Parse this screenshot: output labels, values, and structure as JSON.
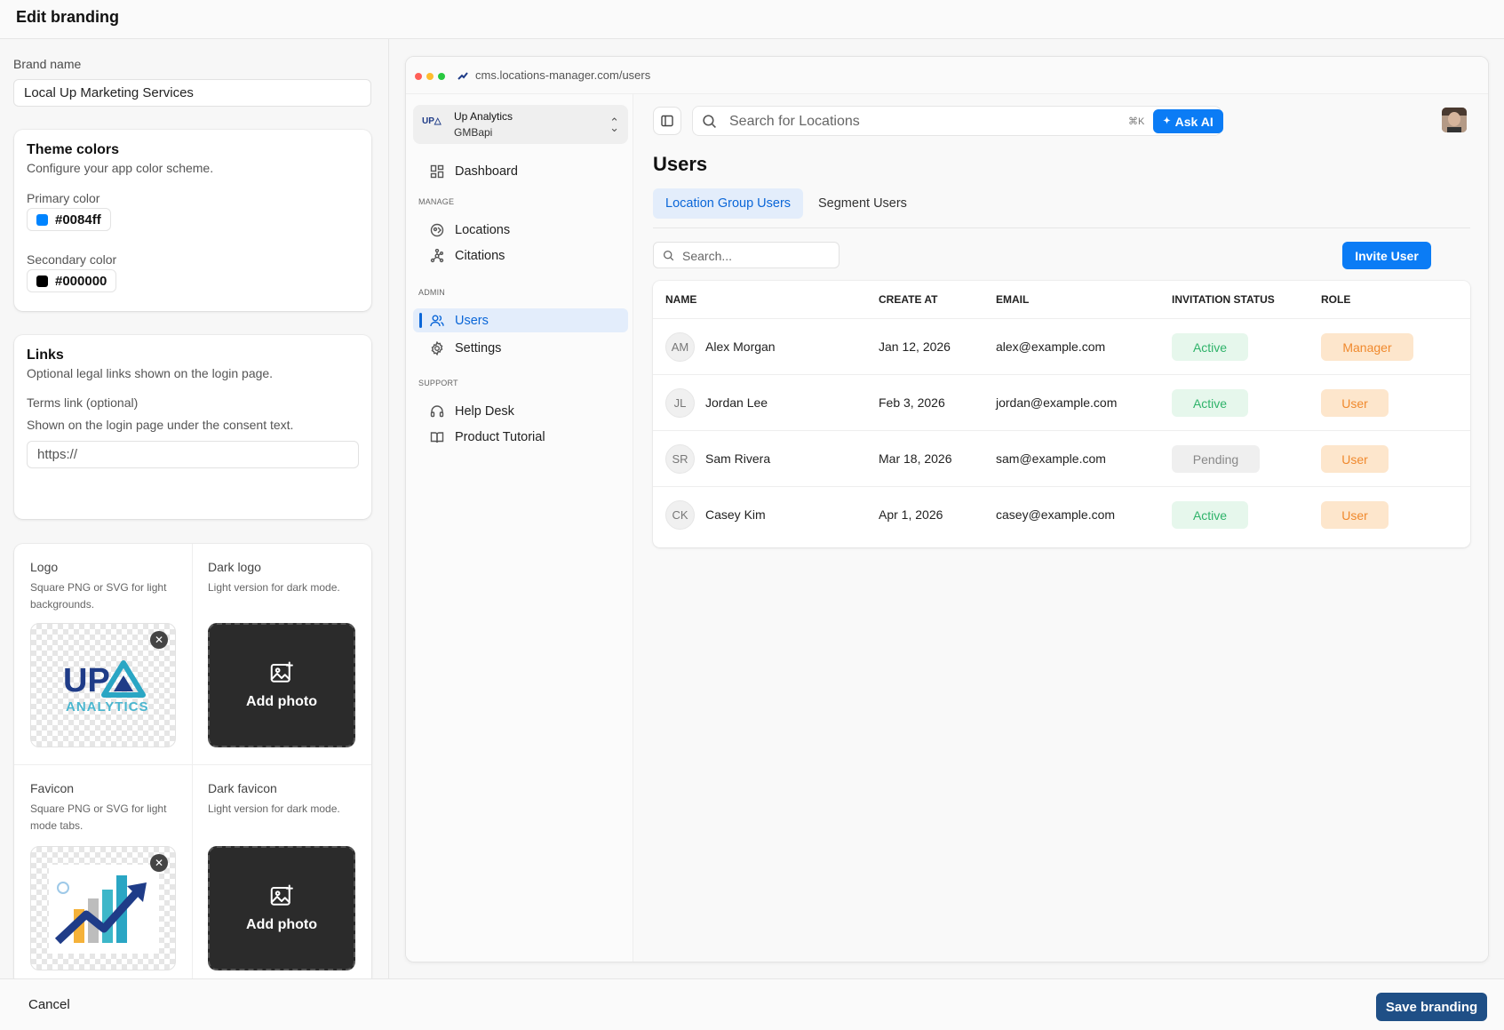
{
  "header": {
    "title": "Edit branding"
  },
  "brand": {
    "label": "Brand name",
    "value": "Local Up Marketing Services"
  },
  "theme": {
    "title": "Theme colors",
    "subtitle": "Configure your app color scheme.",
    "primary_label": "Primary color",
    "primary_value": "#0084ff",
    "secondary_label": "Secondary color",
    "secondary_value": "#000000"
  },
  "links": {
    "title": "Links",
    "subtitle": "Optional legal links shown on the login page.",
    "terms_label": "Terms link (optional)",
    "terms_help": "Shown on the login page under the consent text.",
    "terms_placeholder": "https://"
  },
  "assets": {
    "logo_title": "Logo",
    "logo_desc": "Square PNG or SVG for light backgrounds.",
    "logo_image_text": [
      "UP",
      "ANALYTICS"
    ],
    "dark_logo_title": "Dark logo",
    "dark_logo_desc": "Light version for dark mode.",
    "favicon_title": "Favicon",
    "favicon_desc": "Square PNG or SVG for light mode tabs.",
    "dark_favicon_title": "Dark favicon",
    "dark_favicon_desc": "Light version for dark mode.",
    "add_photo": "Add photo"
  },
  "footer": {
    "cancel": "Cancel",
    "save": "Save branding"
  },
  "preview": {
    "url": "cms.locations-manager.com/users",
    "org_name": "Up Analytics",
    "org_sub": "GMBapi",
    "org_logo_text": "UP△",
    "nav": {
      "dashboard": "Dashboard",
      "manage_label": "MANAGE",
      "locations": "Locations",
      "citations": "Citations",
      "admin_label": "ADMIN",
      "users": "Users",
      "settings": "Settings",
      "support_label": "SUPPORT",
      "help_desk": "Help Desk",
      "product_tutorial": "Product Tutorial"
    },
    "search_placeholder": "Search for Locations",
    "search_kbd": "⌘K",
    "ask_ai": "Ask AI",
    "page_title": "Users",
    "tabs": [
      "Location Group Users",
      "Segment Users"
    ],
    "table_search_placeholder": "Search...",
    "invite_button": "Invite User",
    "columns": [
      "NAME",
      "CREATE AT",
      "EMAIL",
      "INVITATION STATUS",
      "ROLE"
    ],
    "rows": [
      {
        "initials": "AM",
        "name": "Alex Morgan",
        "created": "Jan 12, 2026",
        "email": "alex@example.com",
        "status": "Active",
        "role": "Manager"
      },
      {
        "initials": "JL",
        "name": "Jordan Lee",
        "created": "Feb 3, 2026",
        "email": "jordan@example.com",
        "status": "Active",
        "role": "User"
      },
      {
        "initials": "SR",
        "name": "Sam Rivera",
        "created": "Mar 18, 2026",
        "email": "sam@example.com",
        "status": "Pending",
        "role": "User"
      },
      {
        "initials": "CK",
        "name": "Casey Kim",
        "created": "Apr 1, 2026",
        "email": "casey@example.com",
        "status": "Active",
        "role": "User"
      }
    ]
  },
  "colors": {
    "accent": "#0b7cf5",
    "save_button": "#1f4f86",
    "active_green": "#2fb36a",
    "role_orange": "#f0892d"
  }
}
